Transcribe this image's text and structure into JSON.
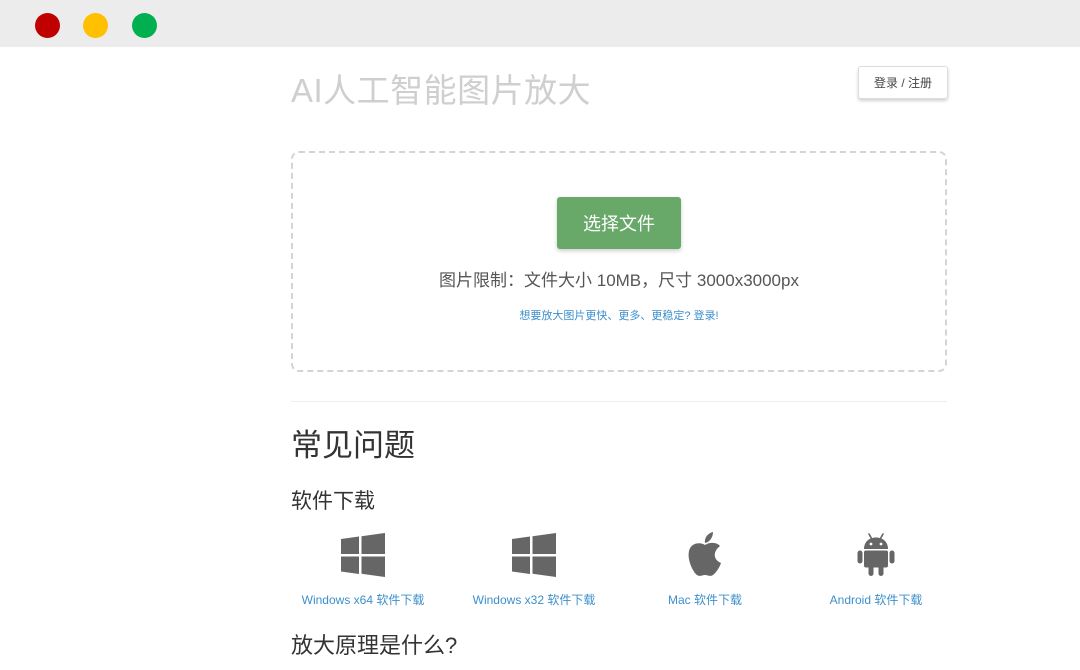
{
  "window": {
    "controls": [
      "close",
      "minimize",
      "maximize"
    ],
    "colors": {
      "close": "#c00000",
      "minimize": "#ffc000",
      "maximize": "#00b050"
    }
  },
  "header": {
    "title": "AI人工智能图片放大",
    "login_label": "登录 / 注册"
  },
  "upload": {
    "button_label": "选择文件",
    "limit_text": "图片限制：文件大小 10MB，尺寸 3000x3000px",
    "upsell_link": "想要放大图片更快、更多、更稳定? 登录!",
    "button_color": "#68a96a"
  },
  "faq": {
    "heading": "常见问题",
    "download_heading": "软件下载",
    "downloads": [
      {
        "icon": "windows-icon",
        "label": "Windows x64 软件下载"
      },
      {
        "icon": "windows-icon",
        "label": "Windows x32 软件下载"
      },
      {
        "icon": "apple-icon",
        "label": "Mac 软件下载"
      },
      {
        "icon": "android-icon",
        "label": "Android 软件下载"
      }
    ],
    "principle_heading": "放大原理是什么?"
  }
}
